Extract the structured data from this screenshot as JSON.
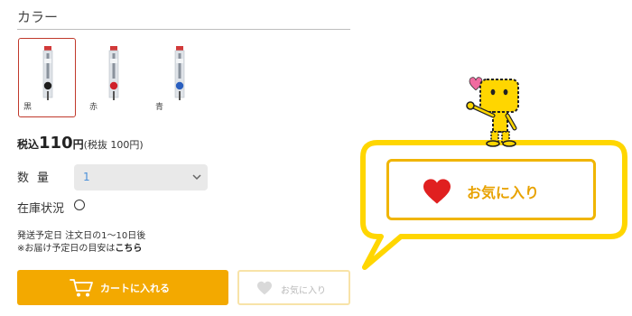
{
  "color_section": {
    "heading": "カラー",
    "options": [
      {
        "label": "黒",
        "ink_color": "#1e1e1e",
        "selected": true
      },
      {
        "label": "赤",
        "ink_color": "#d0202a",
        "selected": false
      },
      {
        "label": "青",
        "ink_color": "#2a5fbf",
        "selected": false
      }
    ]
  },
  "price": {
    "prefix": "税込",
    "amount": "110",
    "yen": "円",
    "tax_excluded": "(税抜 100円)"
  },
  "quantity": {
    "label": "数量",
    "value": "1"
  },
  "stock": {
    "label": "在庫状況"
  },
  "shipping": {
    "line1": "発送予定日 注文日の1〜10日後",
    "line2_prefix": "※お届け予定日の目安は",
    "line2_link": "こちら"
  },
  "cart_button": {
    "label": "カートに入れる",
    "icon": "cart-icon"
  },
  "favorite_button": {
    "label": "お気に入り",
    "icon": "heart-icon"
  },
  "callout": {
    "label": "お気に入り",
    "icon": "heart-icon"
  },
  "colors": {
    "accent_orange": "#f3a900",
    "callout_yellow": "#ffd600",
    "heart_red": "#e02020",
    "selected_border": "#c0392b",
    "mascot_heart": "#f06ba0"
  }
}
